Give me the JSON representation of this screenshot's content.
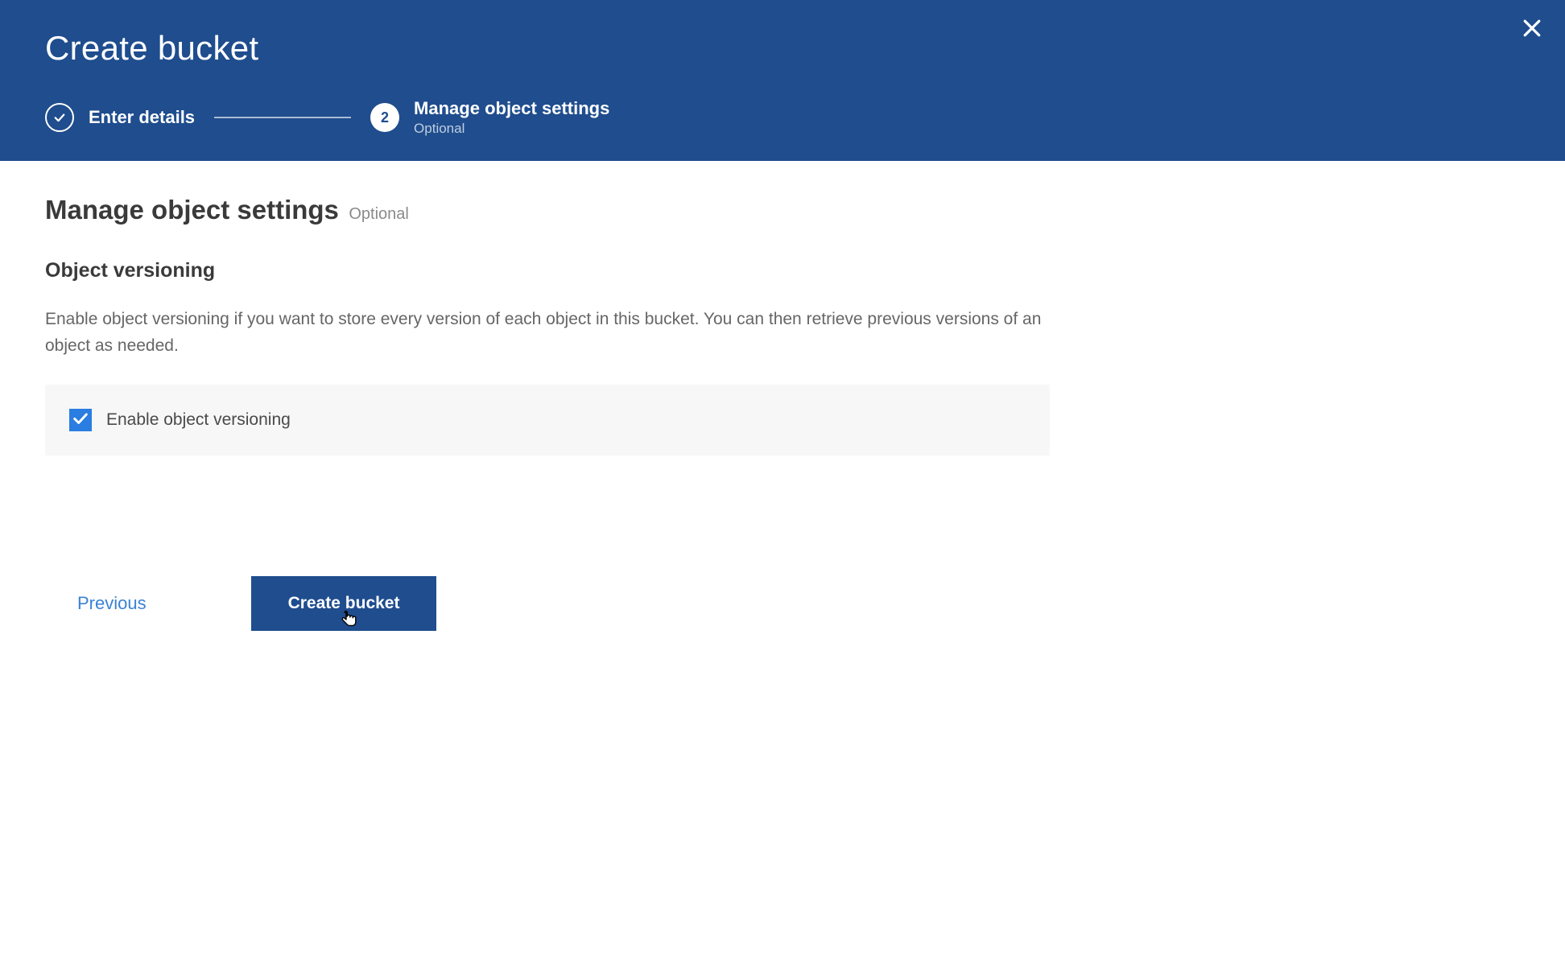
{
  "header": {
    "title": "Create bucket",
    "steps": [
      {
        "label": "Enter details",
        "state": "done"
      },
      {
        "number": "2",
        "label": "Manage object settings",
        "sub": "Optional",
        "state": "current"
      }
    ]
  },
  "main": {
    "section_title": "Manage object settings",
    "section_tag": "Optional",
    "subsection_title": "Object versioning",
    "description": "Enable object versioning if you want to store every version of each object in this bucket. You can then retrieve previous versions of an object as needed.",
    "checkbox_label": "Enable object versioning",
    "checkbox_checked": true
  },
  "footer": {
    "previous": "Previous",
    "submit": "Create bucket"
  }
}
